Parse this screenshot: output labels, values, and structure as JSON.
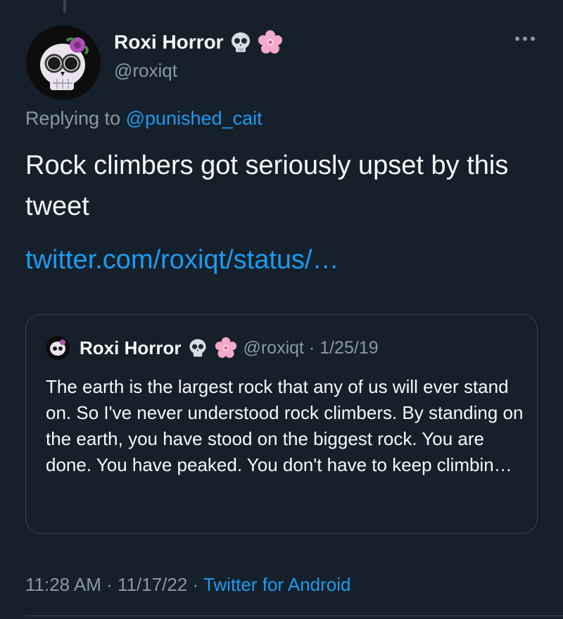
{
  "tweet": {
    "author": {
      "display_name": "Roxi Horror",
      "emoji_1": "skull-emoji",
      "emoji_2": "cherry-blossom-emoji",
      "handle": "@roxiqt"
    },
    "replying_prefix": "Replying to ",
    "replying_to": "@punished_cait",
    "text": "Rock climbers got seriously upset by this tweet",
    "link": "twitter.com/roxiqt/status/…",
    "quoted": {
      "display_name": "Roxi Horror",
      "handle_date": "@roxiqt · 1/25/19",
      "text": "The earth is the largest rock that any of us will ever stand on. So I've never understood rock climbers. By standing on the earth, you have stood on the biggest rock. You are done. You have peaked. You don't have to keep climbin…"
    },
    "timestamp": "11:28 AM · 11/17/22 · ",
    "source": "Twitter for Android"
  },
  "colors": {
    "background": "#15202b",
    "text": "#f7f9f9",
    "secondary": "#8b98a5",
    "link": "#1d9bf0",
    "border": "#38444d"
  }
}
